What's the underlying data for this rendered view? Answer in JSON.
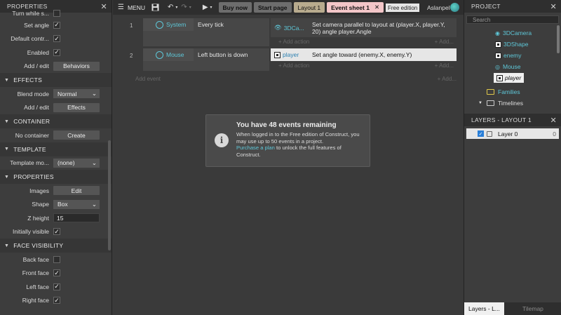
{
  "left_panel": {
    "title": "PROPERTIES",
    "rows_top": [
      {
        "label": "Turn while s...",
        "type": "checkbox",
        "checked": false
      },
      {
        "label": "Set angle",
        "type": "checkbox",
        "checked": true
      },
      {
        "label": "Default contr...",
        "type": "checkbox",
        "checked": true
      },
      {
        "label": "Enabled",
        "type": "checkbox",
        "checked": true
      },
      {
        "label": "Add / edit",
        "type": "button",
        "value": "Behaviors"
      }
    ],
    "effects": {
      "title": "EFFECTS",
      "blend_label": "Blend mode",
      "blend_value": "Normal",
      "add_label": "Add / edit",
      "add_value": "Effects"
    },
    "container": {
      "title": "CONTAINER",
      "label": "No container",
      "value": "Create"
    },
    "template": {
      "title": "TEMPLATE",
      "label": "Template mo...",
      "value": "(none)"
    },
    "properties": {
      "title": "PROPERTIES",
      "images_label": "Images",
      "images_value": "Edit",
      "shape_label": "Shape",
      "shape_value": "Box",
      "zheight_label": "Z height",
      "zheight_value": "15",
      "visible_label": "Initially visible"
    },
    "face": {
      "title": "FACE VISIBILITY",
      "back": "Back face",
      "front": "Front face",
      "left": "Left face",
      "right": "Right face"
    }
  },
  "toolbar": {
    "menu": "MENU",
    "tabs": [
      "Buy now",
      "Start page",
      "Layout 1",
      "Event sheet 1"
    ],
    "edition": "Free edition",
    "user": "Aslanpel"
  },
  "events": [
    {
      "num": "1",
      "cond_object": "System",
      "cond_text": "Every tick",
      "act_object": "3DCa...",
      "act_text": "Set camera parallel to layout at (player.X, player.Y, 20) angle player.Angle"
    },
    {
      "num": "2",
      "cond_object": "Mouse",
      "cond_text": "Left button is down",
      "act_object": "player",
      "act_text": "Set angle toward (enemy.X, enemy.Y)"
    }
  ],
  "sheet": {
    "add_action": "Add action",
    "add_event": "Add event",
    "add_small": "Add..."
  },
  "dialog": {
    "title": "You have 48 events remaining",
    "line1": "When logged in to the Free edition of Construct, you may use up to 50 events in a project.",
    "link": "Purchase a plan",
    "line2": " to unlock the full features of Construct."
  },
  "project": {
    "title": "PROJECT",
    "search_placeholder": "Search",
    "items": [
      "3DCamera",
      "3DShape",
      "enemy",
      "Mouse",
      "player",
      "Families",
      "Timelines"
    ]
  },
  "layers": {
    "title": "LAYERS - LAYOUT 1",
    "layer_name": "Layer 0",
    "layer_count": "0",
    "tab_active": "Layers - L...",
    "tab_inactive": "Tilemap"
  }
}
